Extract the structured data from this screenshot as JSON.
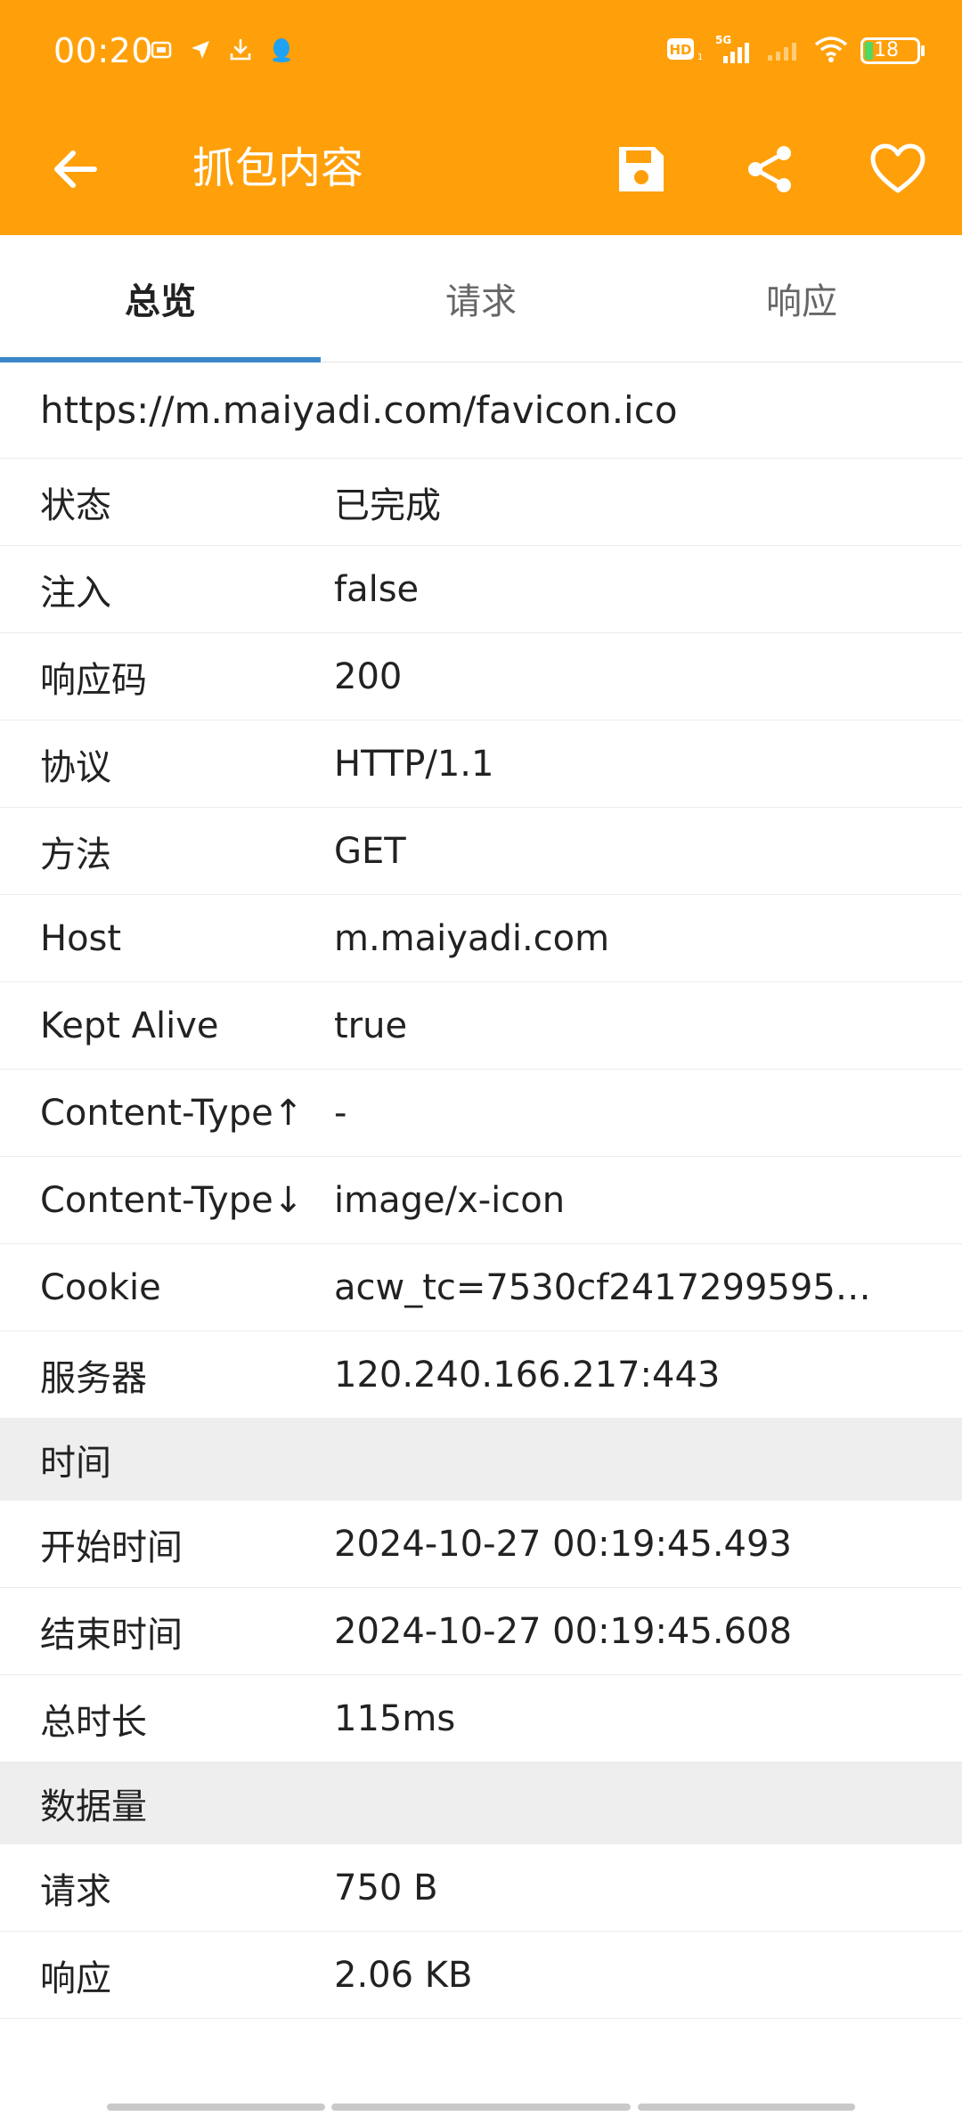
{
  "status_bar": {
    "time": "00:20",
    "battery": "18"
  },
  "appbar": {
    "title": "抓包内容",
    "back_icon": "arrow-left-icon",
    "save_icon": "save-icon",
    "share_icon": "share-icon",
    "favorite_icon": "heart-icon"
  },
  "tabs": [
    {
      "label": "总览",
      "active": true
    },
    {
      "label": "请求",
      "active": false
    },
    {
      "label": "响应",
      "active": false
    }
  ],
  "url": "https://m.maiyadi.com/favicon.ico",
  "overview": [
    {
      "key": "状态",
      "value": "已完成"
    },
    {
      "key": "注入",
      "value": "false"
    },
    {
      "key": "响应码",
      "value": "200"
    },
    {
      "key": "协议",
      "value": "HTTP/1.1"
    },
    {
      "key": "方法",
      "value": "GET"
    },
    {
      "key": "Host",
      "value": "m.maiyadi.com"
    },
    {
      "key": "Kept Alive",
      "value": "true"
    },
    {
      "key": "Content-Type↑",
      "value": "-"
    },
    {
      "key": "Content-Type↓",
      "value": "image/x-icon"
    },
    {
      "key": "Cookie",
      "value": "acw_tc=7530cf2417299595…"
    },
    {
      "key": "服务器",
      "value": "120.240.166.217:443"
    }
  ],
  "time_section": {
    "title": "时间",
    "rows": [
      {
        "key": "开始时间",
        "value": "2024-10-27 00:19:45.493"
      },
      {
        "key": "结束时间",
        "value": "2024-10-27 00:19:45.608"
      },
      {
        "key": "总时长",
        "value": "115ms"
      }
    ]
  },
  "data_section": {
    "title": "数据量",
    "rows": [
      {
        "key": "请求",
        "value": "750 B"
      },
      {
        "key": "响应",
        "value": "2.06 KB"
      }
    ]
  },
  "colors": {
    "accent": "#FFA00A",
    "tab_indicator": "#3A86C8",
    "section_bg": "#EEEEEE"
  }
}
